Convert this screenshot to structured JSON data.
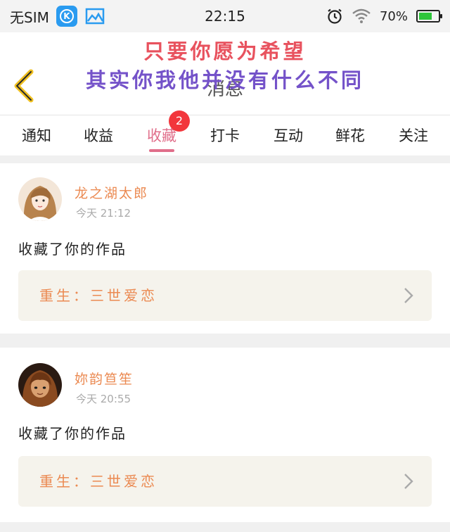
{
  "status_bar": {
    "carrier": "无SIM",
    "time": "22:15",
    "battery_percent_text": "70%",
    "battery_level": 0.7,
    "app_icon_letter": "K"
  },
  "header": {
    "title": "消息",
    "overlay_line1": "只要你愿为希望",
    "overlay_line2": "其实你我他并没有什么不同"
  },
  "tabs": [
    {
      "label": "通知"
    },
    {
      "label": "收益"
    },
    {
      "label": "收藏",
      "active": true,
      "badge": "2"
    },
    {
      "label": "打卡"
    },
    {
      "label": "互动"
    },
    {
      "label": "鲜花"
    },
    {
      "label": "关注"
    }
  ],
  "items": [
    {
      "username": "龙之湖太郎",
      "time": "今天 21:12",
      "action": "收藏了你的作品",
      "work_title": "重生：三世爱恋"
    },
    {
      "username": "妳韵笪笙",
      "time": "今天 20:55",
      "action": "收藏了你的作品",
      "work_title": "重生：三世爱恋"
    }
  ],
  "colors": {
    "accent": "#e06e8a",
    "username": "#eb8a52",
    "badge": "#f2363c",
    "overlay1": "#e8525e",
    "overlay2": "#7452c9"
  }
}
